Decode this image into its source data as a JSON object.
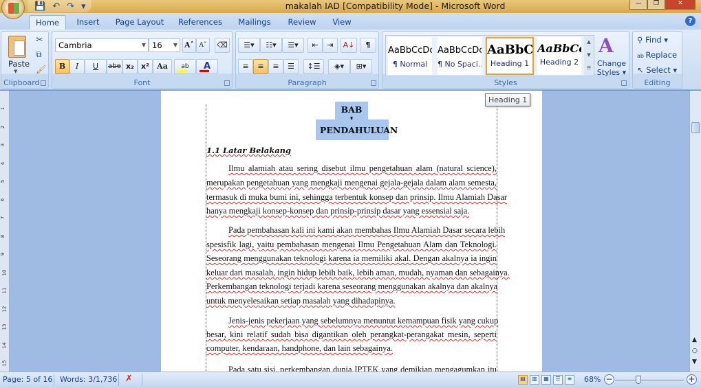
{
  "window": {
    "title": "makalah IAD [Compatibility Mode] - Microsoft Word"
  },
  "qat": {
    "save": "💾",
    "undo": "↶",
    "redo": "↷",
    "customize": "▾"
  },
  "tabs": [
    "Home",
    "Insert",
    "Page Layout",
    "References",
    "Mailings",
    "Review",
    "View"
  ],
  "active_tab": "Home",
  "ribbon": {
    "clipboard": {
      "label": "Clipboard",
      "paste": "Paste"
    },
    "font": {
      "label": "Font",
      "family": "Cambria",
      "size": "16",
      "bold": "B",
      "italic": "I",
      "underline": "U",
      "strike": "abe",
      "subscript": "x₂",
      "superscript": "x²",
      "change_case": "Aa",
      "grow": "A˄",
      "shrink": "A˅",
      "highlight_color": "#ffff00",
      "font_color": "#e00000"
    },
    "paragraph": {
      "label": "Paragraph",
      "show_marks": "¶"
    },
    "styles": {
      "label": "Styles",
      "items": [
        {
          "sample": "AaBbCcDc",
          "name": "¶ Normal"
        },
        {
          "sample": "AaBbCcDc",
          "name": "¶ No Spaci..."
        },
        {
          "sample": "AaBbC(",
          "name": "Heading 1"
        },
        {
          "sample": "AaBbCc",
          "name": "Heading 2"
        }
      ],
      "selected": "Heading 1",
      "change_styles": "Change Styles ▾"
    },
    "editing": {
      "label": "Editing",
      "find": "Find ▾",
      "replace": "Replace",
      "select": "Select ▾"
    }
  },
  "tooltip": "Heading 1",
  "document": {
    "chapter": "BAB I",
    "chapter_title": "PENDAHULUAN",
    "section": "1.1 Latar Belakang",
    "paragraphs": [
      [
        "Ilmu alamiah atau sering disebut ilmu pengetahuan alam (natural science),",
        "merupakan pengetahuan yang mengkaji mengenai gejala-gejala dalam alam semesta,",
        "termasuk di muka bumi ini, sehingga terbentuk konsep dan prinsip. Ilmu Alamiah Dasar",
        "hanya mengkaji konsep-konsep dan prinsip-prinsip dasar yang essensial saja."
      ],
      [
        "Pada pembahasan kali ini kami akan membahas Ilmu Alamiah Dasar secara lebih",
        "spesisfik lagi, yaitu pembahasan mengenai Ilmu Pengetahuan Alam dan Teknologi.",
        "Seseorang menggunakan teknologi karena ia memiliki akal. Dengan akalnya ia ingin",
        "keluar dari masalah, ingin hidup lebih baik, lebih aman, mudah, nyaman dan sebagainya.",
        "Perkembangan teknologi terjadi karena seseorang menggunakan akalnya dan akalnya",
        "untuk menyelesaikan setiap masalah yang dihadapinya."
      ],
      [
        "Jenis-jenis pekerjaan yang sebelumnya menuntut kemampuan fisik yang cukup",
        "besar, kini relatif sudah bisa digantikan oleh perangkat-perangakat mesin, seperti",
        "computer, kendaraan, handphone, dan lain sebagainya."
      ],
      [
        "Pada satu sisi, perkembangan dunia IPTEK yang demikian mengagumkan itu"
      ]
    ]
  },
  "ruler_ticks": [
    "1",
    "2",
    "3",
    "4",
    "5",
    "6",
    "7",
    "8",
    "9",
    "10",
    "11",
    "12",
    "13",
    "14",
    "15"
  ],
  "status": {
    "page": "Page: 5 of 16",
    "words": "Words: 3/1,736",
    "zoom": "68%",
    "zoom_value": 68
  }
}
